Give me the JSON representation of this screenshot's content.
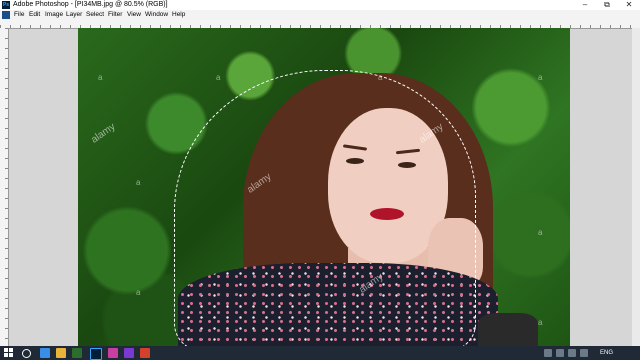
{
  "window": {
    "title": "Adobe Photoshop - [PI34MB.jpg @ 80.5% (RGB)]",
    "controls": {
      "minimize": "–",
      "restore": "⧉",
      "close": "✕"
    }
  },
  "menu": {
    "items": [
      "File",
      "Edit",
      "Image",
      "Layer",
      "Select",
      "Filter",
      "View",
      "Window",
      "Help"
    ]
  },
  "canvas": {
    "watermark_text": "alamy",
    "watermark_mark": "a"
  },
  "taskbar": {
    "language": "ENG",
    "icons": [
      "windows-start-icon",
      "search-icon",
      "task-view-icon",
      "file-explorer-icon",
      "store-icon",
      "photoshop-icon",
      "app-icon-1",
      "app-icon-2",
      "app-icon-3",
      "app-icon-4"
    ]
  },
  "colors": {
    "taskbar_bg": "#1f2a36",
    "lips": "#b0142a",
    "hair": "#5a2e1c",
    "foliage": "#2a6a1c"
  }
}
